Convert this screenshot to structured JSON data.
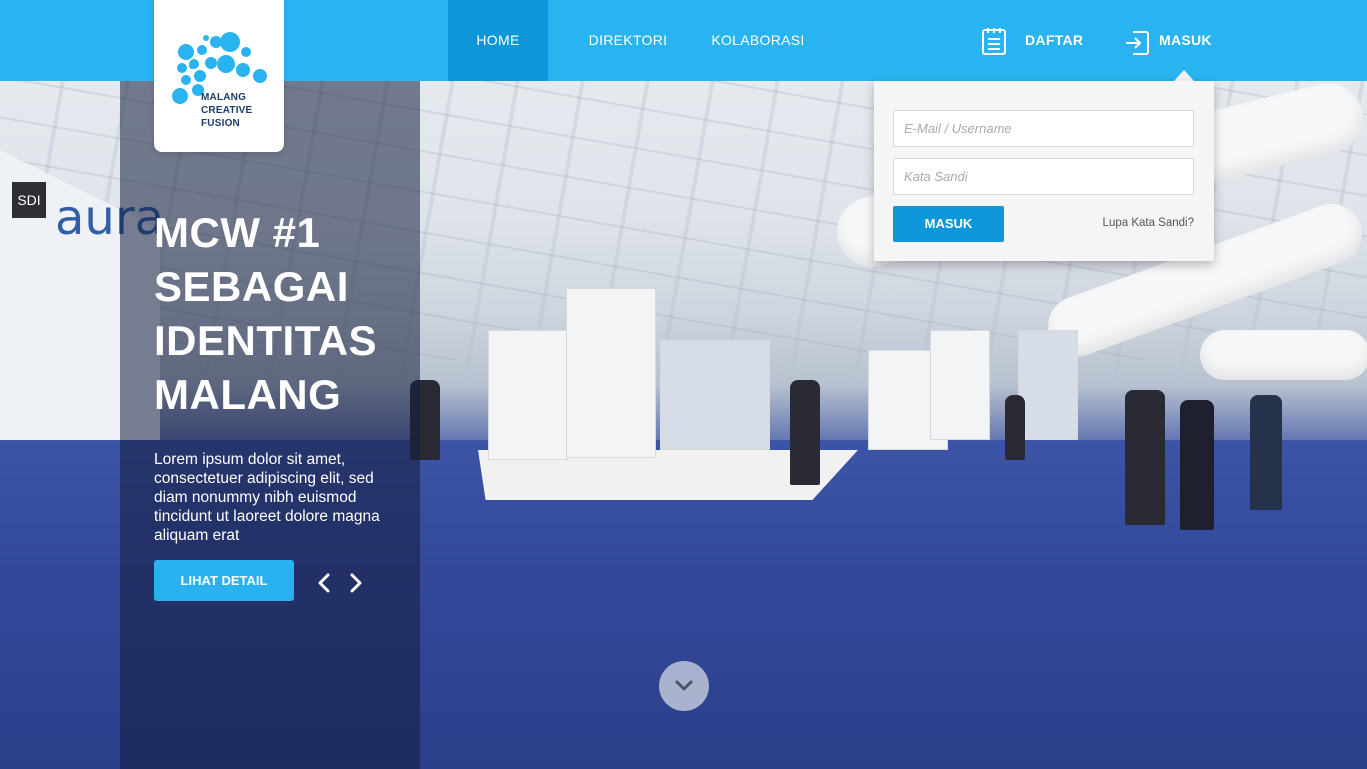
{
  "header": {
    "nav": {
      "home": "HOME",
      "direktori": "DIREKTORI",
      "kolaborasi": "KOLABORASI",
      "daftar": "DAFTAR",
      "masuk": "MASUK"
    },
    "active_tab": "HOME",
    "colors": {
      "bar": "#29b3f0",
      "active": "#0e96db"
    }
  },
  "logo": {
    "line1": "MALANG",
    "line2": "CREATIVE",
    "line3": "FUSION"
  },
  "hero": {
    "title_lines": [
      "MCW #1",
      "SEBAGAI",
      "IDENTITAS",
      "MALANG"
    ],
    "description": "Lorem ipsum dolor sit amet, consectetuer adipiscing elit, sed diam nonummy nibh euismod tincidunt ut laoreet dolore magna aliquam erat",
    "detail_button": "LIHAT DETAIL",
    "prev_icon": "chevron-left-icon",
    "next_icon": "chevron-right-icon",
    "scroll_icon": "chevron-down-icon"
  },
  "background": {
    "booth_signs": [
      "SDI",
      "aura"
    ]
  },
  "login": {
    "email_placeholder": "E-Mail / Username",
    "password_placeholder": "Kata Sandi",
    "submit": "MASUK",
    "forgot": "Lupa Kata Sandi?"
  }
}
